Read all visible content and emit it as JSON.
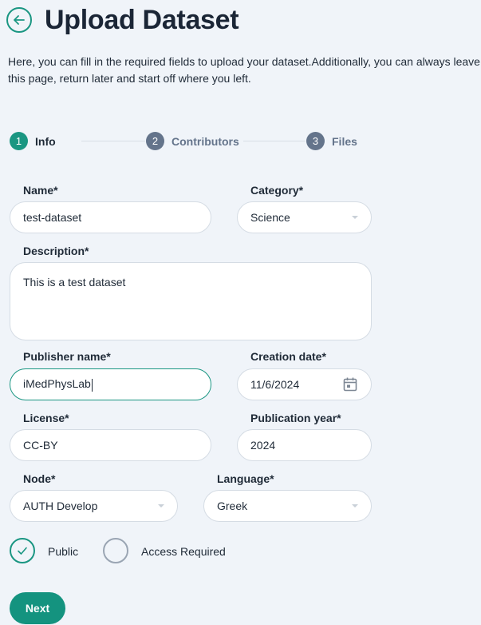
{
  "header": {
    "title": "Upload Dataset",
    "intro": "Here, you can fill in the required fields to upload your dataset.Additionally, you can always leave this page, return later and start off where you left."
  },
  "stepper": {
    "steps": [
      {
        "number": "1",
        "label": "Info",
        "active": true
      },
      {
        "number": "2",
        "label": "Contributors",
        "active": false
      },
      {
        "number": "3",
        "label": "Files",
        "active": false
      }
    ]
  },
  "form": {
    "name": {
      "label": "Name*",
      "value": "test-dataset"
    },
    "category": {
      "label": "Category*",
      "value": "Science"
    },
    "description": {
      "label": "Description*",
      "value": "This is a test dataset"
    },
    "publisher": {
      "label": "Publisher name*",
      "value": "iMedPhysLab"
    },
    "creation_date": {
      "label": "Creation date*",
      "value": "11/6/2024"
    },
    "license": {
      "label": "License*",
      "value": "CC-BY"
    },
    "publication_year": {
      "label": "Publication year*",
      "value": "2024"
    },
    "node": {
      "label": "Node*",
      "value": "AUTH Develop"
    },
    "language": {
      "label": "Language*",
      "value": "Greek"
    }
  },
  "access": {
    "public_label": "Public",
    "access_required_label": "Access Required",
    "selected": "public"
  },
  "actions": {
    "next_label": "Next"
  },
  "colors": {
    "accent": "#1a9682",
    "muted": "#64748b",
    "background": "#f0f4f9"
  }
}
